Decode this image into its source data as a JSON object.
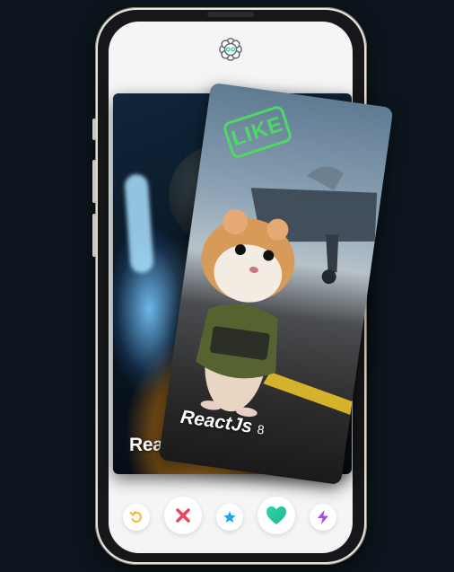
{
  "app": {
    "logo_icon": "flower-logo-icon"
  },
  "cards": [
    {
      "name": "Reac",
      "layer": "back"
    },
    {
      "name": "ReactJs",
      "age": "8",
      "layer": "front",
      "stamp": "LIKE"
    }
  ],
  "actions": [
    {
      "name": "rewind",
      "icon": "undo-icon",
      "color": "#f5b731"
    },
    {
      "name": "nope",
      "icon": "close-icon",
      "color": "#f0425d"
    },
    {
      "name": "super-like",
      "icon": "star-icon",
      "color": "#1ea4f2"
    },
    {
      "name": "like",
      "icon": "heart-icon",
      "color": "#2ed3a7"
    },
    {
      "name": "boost",
      "icon": "bolt-icon",
      "color": "#a34ee0"
    }
  ],
  "colors": {
    "background": "#0c151d",
    "like_stamp": "#4cd964"
  }
}
